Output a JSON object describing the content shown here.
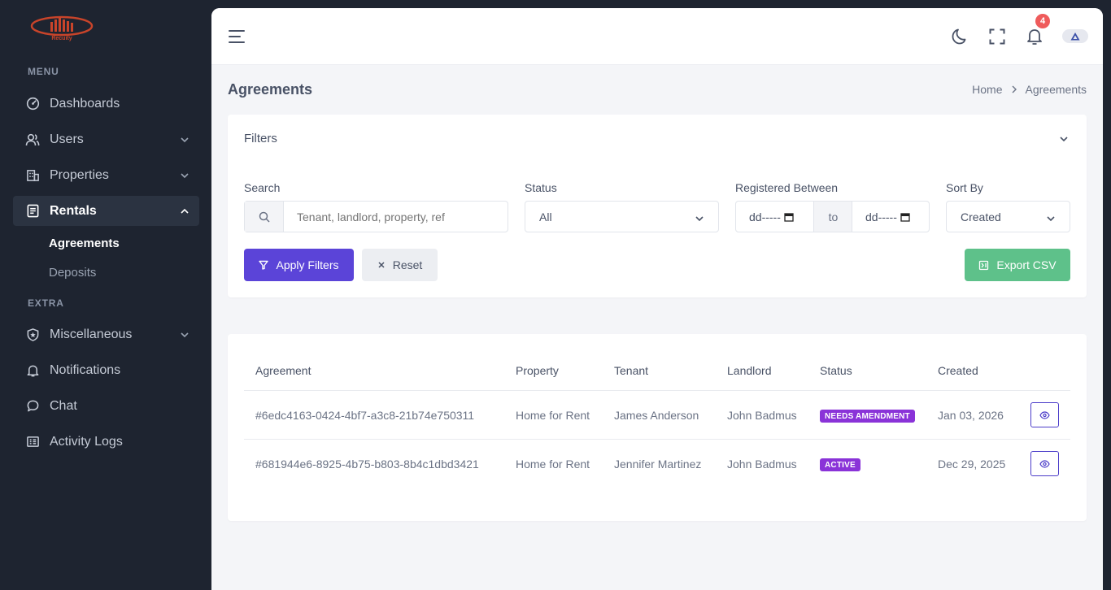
{
  "sidebar": {
    "logo_text": "Recuity",
    "menu_title": "MENU",
    "extra_title": "EXTRA",
    "items": [
      {
        "label": "Dashboards",
        "icon": "gauge-icon"
      },
      {
        "label": "Users",
        "icon": "users-icon"
      },
      {
        "label": "Properties",
        "icon": "building-icon"
      },
      {
        "label": "Rentals",
        "icon": "document-icon"
      },
      {
        "label": "Miscellaneous",
        "icon": "shield-star-icon"
      },
      {
        "label": "Notifications",
        "icon": "bell-icon"
      },
      {
        "label": "Chat",
        "icon": "chat-icon"
      },
      {
        "label": "Activity Logs",
        "icon": "log-icon"
      }
    ],
    "rentals_sub": [
      "Agreements",
      "Deposits"
    ]
  },
  "topbar": {
    "notification_count": "4"
  },
  "page": {
    "title": "Agreements",
    "breadcrumb": [
      "Home",
      "Agreements"
    ]
  },
  "filters": {
    "title": "Filters",
    "search_label": "Search",
    "search_placeholder": "Tenant, landlord, property, ref",
    "status_label": "Status",
    "status_value": "All",
    "registered_label": "Registered Between",
    "date_from": "dd-----",
    "date_sep": "to",
    "date_to": "dd-----",
    "sort_label": "Sort By",
    "sort_value": "Created",
    "apply_label": "Apply Filters",
    "reset_label": "Reset",
    "export_label": "Export CSV"
  },
  "table": {
    "headers": [
      "Agreement",
      "Property",
      "Tenant",
      "Landlord",
      "Status",
      "Created"
    ],
    "rows": [
      {
        "agreement": "#6edc4163-0424-4bf7-a3c8-21b74e750311",
        "property": "Home for Rent",
        "tenant": "James Anderson",
        "landlord": "John Badmus",
        "status": "NEEDS AMENDMENT",
        "created": "Jan 03, 2026"
      },
      {
        "agreement": "#681944e6-8925-4b75-b803-8b4c1dbd3421",
        "property": "Home for Rent",
        "tenant": "Jennifer Martinez",
        "landlord": "John Badmus",
        "status": "ACTIVE",
        "created": "Dec 29, 2025"
      }
    ]
  },
  "colors": {
    "primary": "#5b44d8",
    "success": "#5ec18a",
    "status_badge": "#8a33d8",
    "sidebar_bg": "#1e2430",
    "notification_badge": "#ef5b5b"
  }
}
